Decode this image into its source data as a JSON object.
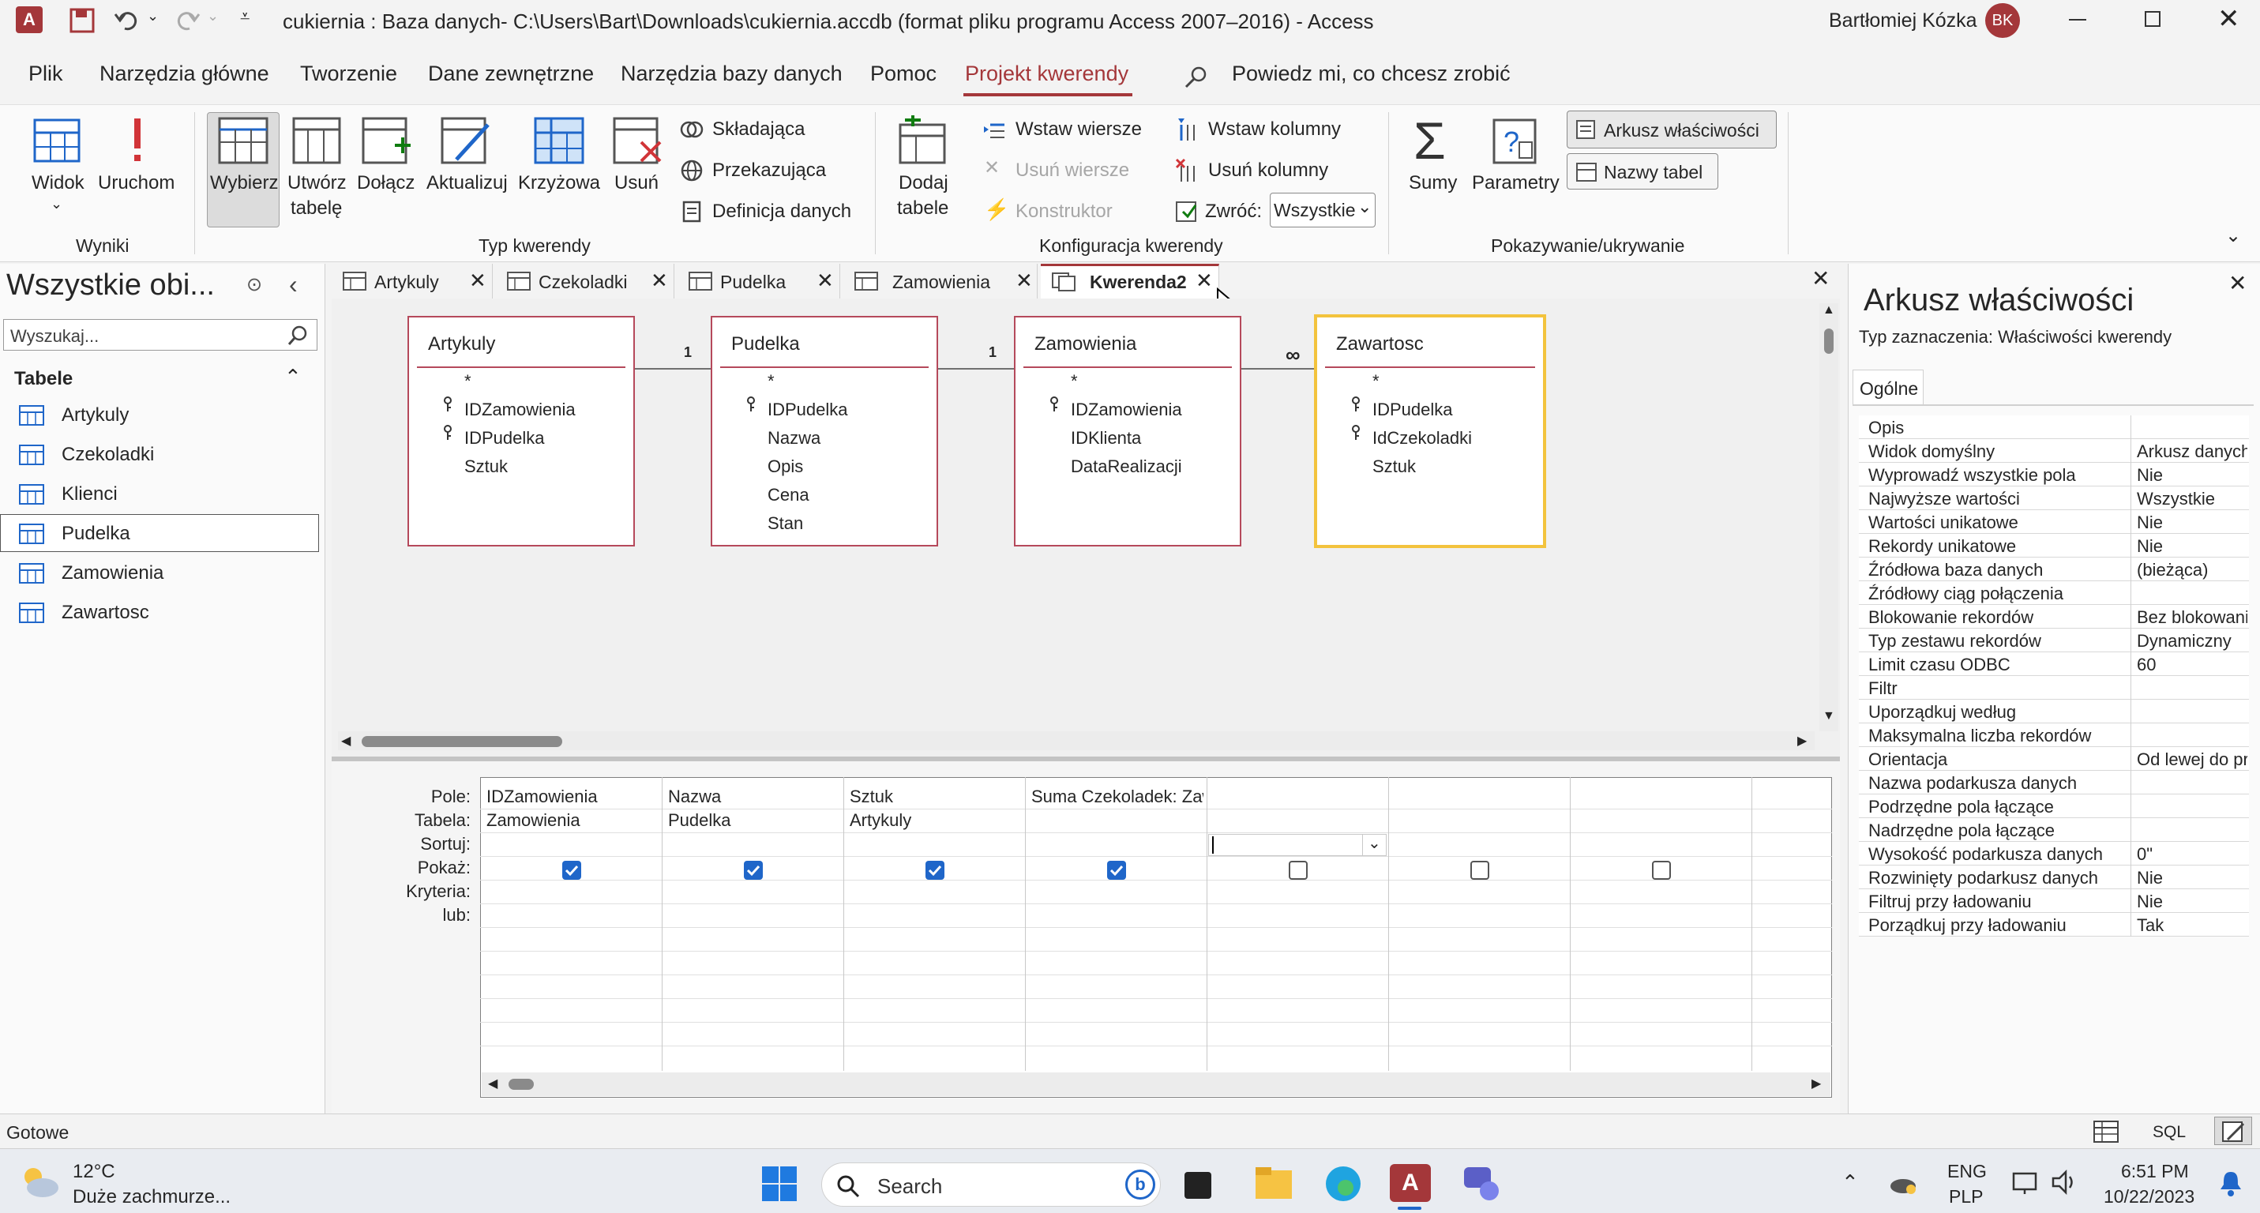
{
  "titlebar": {
    "title": "cukiernia : Baza danych- C:\\Users\\Bart\\Downloads\\cukiernia.accdb (format pliku programu Access 2007–2016)  -  Access",
    "user": "Bartłomiej Kózka",
    "initials": "BK"
  },
  "menu": [
    "Plik",
    "Narzędzia główne",
    "Tworzenie",
    "Dane zewnętrzne",
    "Narzędzia bazy danych",
    "Pomoc",
    "Projekt kwerendy"
  ],
  "tellme": "Powiedz mi, co chcesz zrobić",
  "ribbon": {
    "widok": "Widok",
    "uruchom": "Uruchom",
    "wybierz": "Wybierz",
    "utworz1": "Utwórz",
    "utworz2": "tabelę",
    "dolacz": "Dołącz",
    "aktualizuj": "Aktualizuj",
    "krzyzowa": "Krzyżowa",
    "usun": "Usuń",
    "skladajaca": "Składająca",
    "przekazujaca": "Przekazująca",
    "definicja": "Definicja danych",
    "dodaj1": "Dodaj",
    "dodaj2": "tabele",
    "wstaw_wiersze": "Wstaw wiersze",
    "usun_wiersze": "Usuń wiersze",
    "konstruktor": "Konstruktor",
    "wstaw_kolumny": "Wstaw kolumny",
    "usun_kolumny": "Usuń kolumny",
    "zwroc": "Zwróć:",
    "zwroc_value": "Wszystkie",
    "sumy": "Sumy",
    "parametry": "Parametry",
    "arkusz": "Arkusz właściwości",
    "nazwy": "Nazwy tabel",
    "groups": {
      "wyniki": "Wyniki",
      "typ": "Typ kwerendy",
      "konfig": "Konfiguracja kwerendy",
      "pokaz": "Pokazywanie/ukrywanie"
    }
  },
  "nav": {
    "title": "Wszystkie obi...",
    "search_placeholder": "Wyszukaj...",
    "section": "Tabele",
    "items": [
      "Artykuly",
      "Czekoladki",
      "Klienci",
      "Pudelka",
      "Zamowienia",
      "Zawartosc"
    ]
  },
  "tabs": [
    "Artykuly",
    "Czekoladki",
    "Pudelka",
    "Zamowienia",
    "Kwerenda2"
  ],
  "tables": [
    {
      "name": "Artykuly",
      "fields": [
        "*",
        "IDZamowienia",
        "IDPudelka",
        "Sztuk"
      ]
    },
    {
      "name": "Pudelka",
      "fields": [
        "*",
        "IDPudelka",
        "Nazwa",
        "Opis",
        "Cena",
        "Stan"
      ]
    },
    {
      "name": "Zamowienia",
      "fields": [
        "*",
        "IDZamowienia",
        "IDKlienta",
        "DataRealizacji"
      ]
    },
    {
      "name": "Zawartosc",
      "fields": [
        "*",
        "IDPudelka",
        "IdCzekoladki",
        "Sztuk"
      ]
    }
  ],
  "relations": {
    "one": "1",
    "many": "∞"
  },
  "grid": {
    "labels": [
      "Pole:",
      "Tabela:",
      "Sortuj:",
      "Pokaż:",
      "Kryteria:",
      "lub:"
    ],
    "columns": [
      {
        "field": "IDZamowienia",
        "table": "Zamowienia",
        "show": true
      },
      {
        "field": "Nazwa",
        "table": "Pudelka",
        "show": true
      },
      {
        "field": "Sztuk",
        "table": "Artykuly",
        "show": true
      },
      {
        "field": "Suma Czekoladek: Zaw",
        "table": "",
        "show": true
      },
      {
        "field": "",
        "table": "",
        "show": false
      },
      {
        "field": "",
        "table": "",
        "show": false
      },
      {
        "field": "",
        "table": "",
        "show": false
      }
    ]
  },
  "props": {
    "title": "Arkusz właściwości",
    "type_label": "Typ zaznaczenia:  Właściwości kwerendy",
    "tab": "Ogólne",
    "rows": [
      [
        "Opis",
        ""
      ],
      [
        "Widok domyślny",
        "Arkusz danych"
      ],
      [
        "Wyprowadź wszystkie pola",
        "Nie"
      ],
      [
        "Najwyższe wartości",
        "Wszystkie"
      ],
      [
        "Wartości unikatowe",
        "Nie"
      ],
      [
        "Rekordy unikatowe",
        "Nie"
      ],
      [
        "Źródłowa baza danych",
        "(bieżąca)"
      ],
      [
        "Źródłowy ciąg połączenia",
        ""
      ],
      [
        "Blokowanie rekordów",
        "Bez blokowania"
      ],
      [
        "Typ zestawu rekordów",
        "Dynamiczny"
      ],
      [
        "Limit czasu ODBC",
        "60"
      ],
      [
        "Filtr",
        ""
      ],
      [
        "Uporządkuj według",
        ""
      ],
      [
        "Maksymalna liczba rekordów",
        ""
      ],
      [
        "Orientacja",
        "Od lewej do prawej"
      ],
      [
        "Nazwa podarkusza danych",
        ""
      ],
      [
        "Podrzędne pola łączące",
        ""
      ],
      [
        "Nadrzędne pola łączące",
        ""
      ],
      [
        "Wysokość podarkusza danych",
        "0\""
      ],
      [
        "Rozwinięty podarkusz danych",
        "Nie"
      ],
      [
        "Filtruj przy ładowaniu",
        "Nie"
      ],
      [
        "Porządkuj przy ładowaniu",
        "Tak"
      ]
    ]
  },
  "status": {
    "text": "Gotowe",
    "sql": "SQL"
  },
  "taskbar": {
    "temp": "12°C",
    "weather": "Duże zachmurze...",
    "search": "Search",
    "lang1": "ENG",
    "lang2": "PLP",
    "time": "6:51 PM",
    "date": "10/22/2023"
  }
}
